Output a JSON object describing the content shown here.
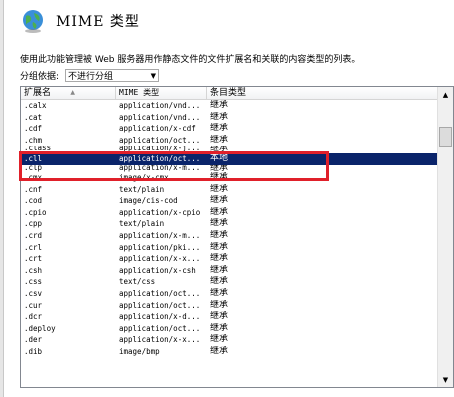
{
  "window": {
    "title": "MIME 类型",
    "icon": "globe-icon"
  },
  "description": "使用此功能管理被 Web 服务器用作静态文件的文件扩展名和关联的内容类型的列表。",
  "grouping": {
    "label": "分组依据:",
    "value": "不进行分组"
  },
  "table": {
    "columns": [
      "扩展名",
      "MIME 类型",
      "条目类型"
    ],
    "sort_indicator": "▲",
    "rows": [
      {
        "ext": ".calx",
        "mime": "application/vnd...",
        "type": "继承"
      },
      {
        "ext": ".cat",
        "mime": "application/vnd...",
        "type": "继承"
      },
      {
        "ext": ".cdf",
        "mime": "application/x-cdf",
        "type": "继承"
      },
      {
        "ext": ".chm",
        "mime": "application/oct...",
        "type": "继承"
      },
      {
        "ext": ".class",
        "mime": "application/x-j...",
        "type": "继承"
      },
      {
        "ext": ".cll",
        "mime": "application/oct...",
        "type": "本地"
      },
      {
        "ext": ".clp",
        "mime": "application/x-m...",
        "type": "继承"
      },
      {
        "ext": ".cmx",
        "mime": "image/x-cmx",
        "type": "继承"
      },
      {
        "ext": ".cnf",
        "mime": "text/plain",
        "type": "继承"
      },
      {
        "ext": ".cod",
        "mime": "image/cis-cod",
        "type": "继承"
      },
      {
        "ext": ".cpio",
        "mime": "application/x-cpio",
        "type": "继承"
      },
      {
        "ext": ".cpp",
        "mime": "text/plain",
        "type": "继承"
      },
      {
        "ext": ".crd",
        "mime": "application/x-m...",
        "type": "继承"
      },
      {
        "ext": ".crl",
        "mime": "application/pki...",
        "type": "继承"
      },
      {
        "ext": ".crt",
        "mime": "application/x-x...",
        "type": "继承"
      },
      {
        "ext": ".csh",
        "mime": "application/x-csh",
        "type": "继承"
      },
      {
        "ext": ".css",
        "mime": "text/css",
        "type": "继承"
      },
      {
        "ext": ".csv",
        "mime": "application/oct...",
        "type": "继承"
      },
      {
        "ext": ".cur",
        "mime": "application/oct...",
        "type": "继承"
      },
      {
        "ext": ".dcr",
        "mime": "application/x-d...",
        "type": "继承"
      },
      {
        "ext": ".deploy",
        "mime": "application/oct...",
        "type": "继承"
      },
      {
        "ext": ".der",
        "mime": "application/x-x...",
        "type": "继承"
      },
      {
        "ext": ".dib",
        "mime": "image/bmp",
        "type": "继承"
      }
    ],
    "selected_index": 5
  },
  "colors": {
    "selection": "#0a246a",
    "annotation": "#e0202a"
  }
}
